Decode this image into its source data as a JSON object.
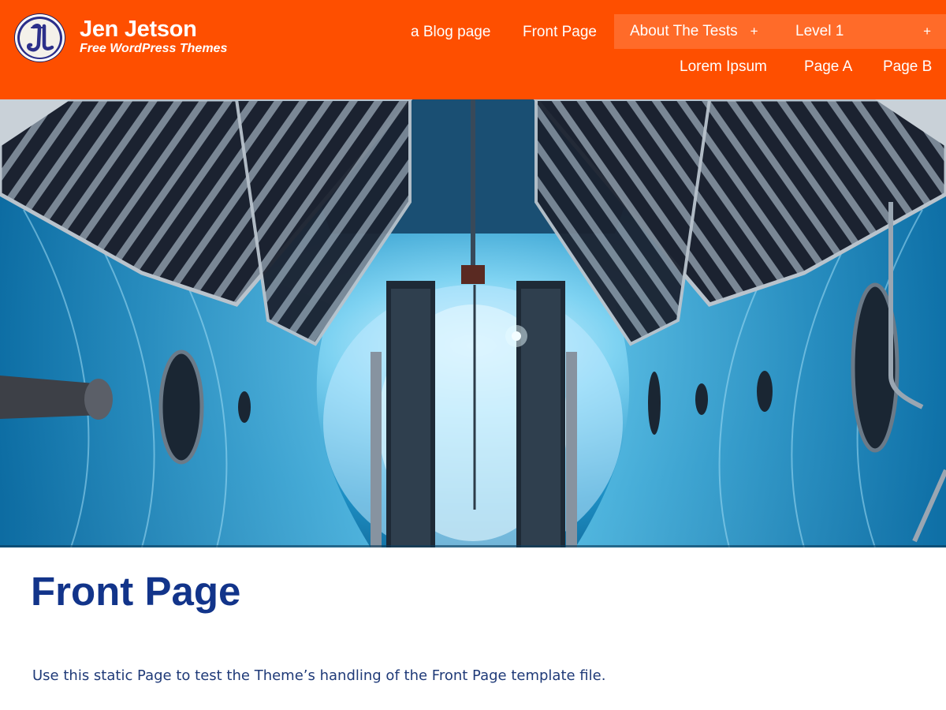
{
  "site": {
    "title": "Jen Jetson",
    "tagline": "Free WordPress Themes",
    "logo_letters": "JL"
  },
  "nav": {
    "row1": [
      {
        "label": "a Blog page"
      },
      {
        "label": "Front Page"
      },
      {
        "label": "About The Tests",
        "submenu_indicator": "+"
      },
      {
        "label": "Level 1",
        "submenu_indicator": "+"
      }
    ],
    "row2": [
      {
        "label": "Lorem Ipsum"
      },
      {
        "label": "Page A"
      },
      {
        "label": "Page B"
      }
    ]
  },
  "hero": {
    "description": ""
  },
  "content": {
    "title": "Front Page",
    "body": "Use this static Page to test the Theme’s handling of the Front Page template file."
  },
  "colors": {
    "header_bg": "#fe4f00",
    "nav_highlight": "#ff6b29",
    "title_blue": "#12348a",
    "body_text": "#1f3a78"
  },
  "icons": {
    "submenu": "plus-icon",
    "logo": "jl-monogram-logo"
  }
}
